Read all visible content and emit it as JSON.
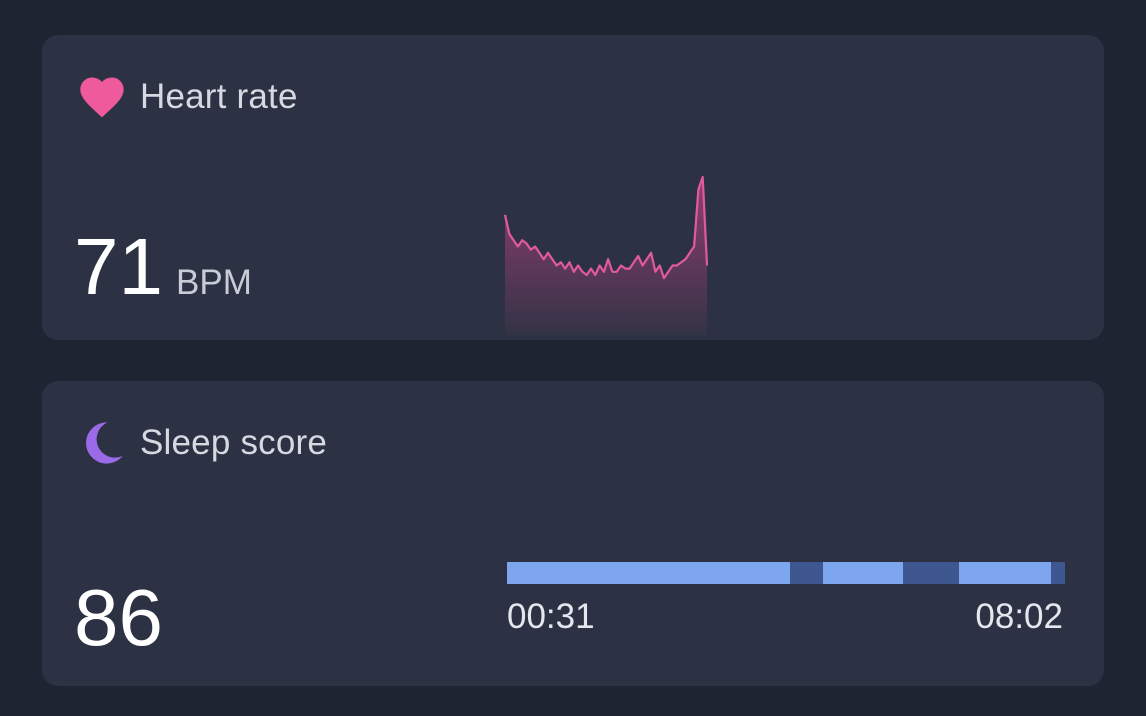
{
  "heart_rate": {
    "title": "Heart rate",
    "icon": "heart-icon",
    "value": "71",
    "unit": "BPM",
    "accent": "#ee5a9c",
    "chart_data": {
      "type": "area",
      "values": [
        88,
        82,
        80,
        78,
        80,
        79,
        77,
        78,
        76,
        74,
        76,
        74,
        72,
        73,
        71,
        73,
        70,
        72,
        70,
        69,
        71,
        69,
        72,
        70,
        74,
        70,
        70,
        72,
        71,
        71,
        73,
        75,
        72,
        74,
        76,
        70,
        72,
        68,
        70,
        72,
        72,
        73,
        74,
        76,
        78,
        96,
        100,
        72
      ]
    }
  },
  "sleep": {
    "title": "Sleep score",
    "icon": "moon-icon",
    "value": "86",
    "accent": "#9b6ae8",
    "start_time": "00:31",
    "end_time": "08:02",
    "segments": [
      {
        "start": 0.0,
        "end": 0.508
      },
      {
        "start": 0.566,
        "end": 0.71
      },
      {
        "start": 0.81,
        "end": 0.975
      }
    ]
  }
}
